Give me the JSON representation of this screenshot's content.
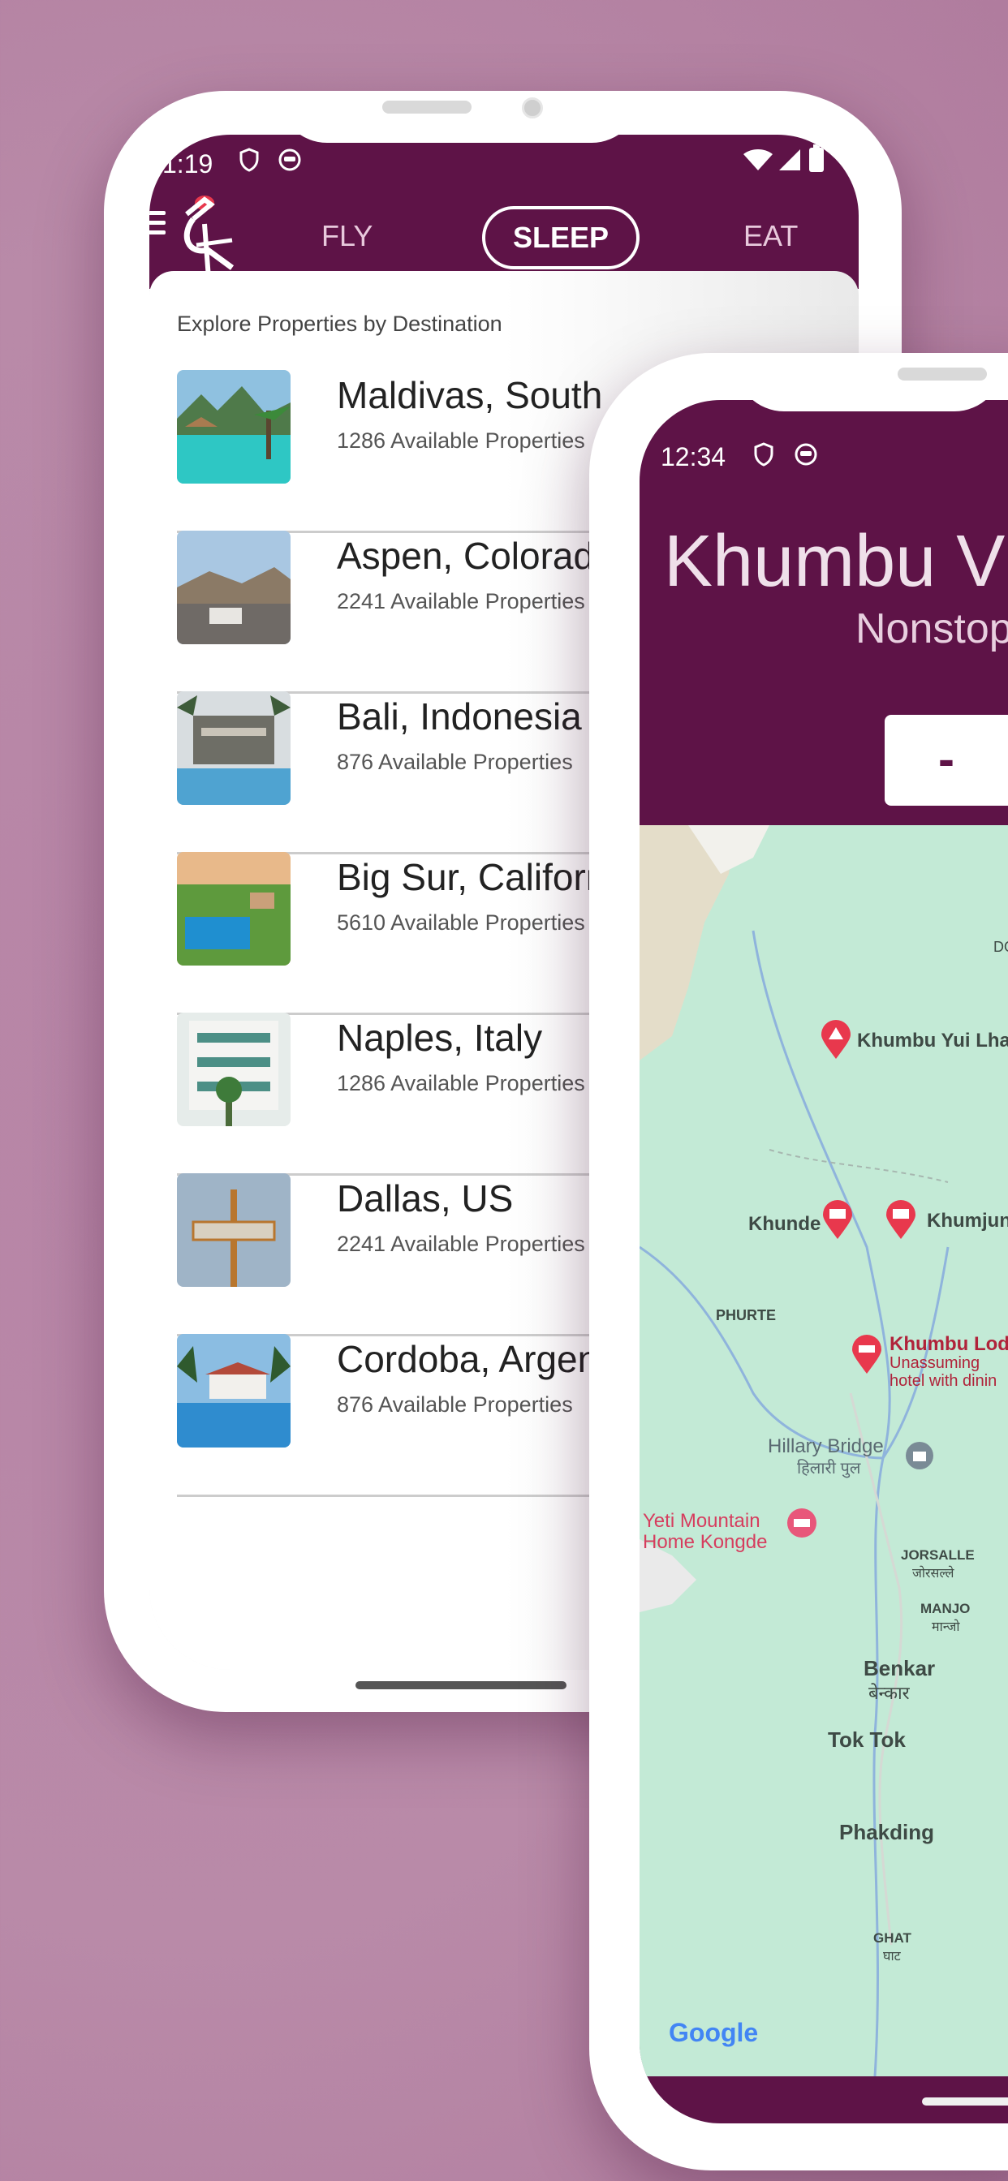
{
  "left_phone": {
    "status": {
      "time": "1:19"
    },
    "nav": {
      "tabs": [
        {
          "label": "FLY"
        },
        {
          "label": "SLEEP"
        },
        {
          "label": "EAT"
        }
      ],
      "active_tab": "SLEEP"
    },
    "section_title": "Explore Properties by Destination",
    "properties": [
      {
        "name": "Maldivas, South",
        "count": "1286 Available Properties"
      },
      {
        "name": "Aspen, Colorado",
        "count": "2241 Available Properties"
      },
      {
        "name": "Bali, Indonesia",
        "count": "876 Available Properties"
      },
      {
        "name": "Big Sur, California",
        "count": "5610 Available Properties"
      },
      {
        "name": "Naples, Italy",
        "count": "1286 Available Properties"
      },
      {
        "name": "Dallas, US",
        "count": "2241 Available Properties"
      },
      {
        "name": "Cordoba, Argentina",
        "count": "876 Available Properties"
      }
    ]
  },
  "right_phone": {
    "status": {
      "time": "12:34"
    },
    "title": "Khumbu V",
    "subtitle": "Nonstop",
    "date_field": "-",
    "map": {
      "labels": {
        "dol": "DOL",
        "yui_lha": "Khumbu Yui Lha",
        "khunde": "Khunde",
        "khumjung": "Khumjun",
        "phurte": "PHURTE",
        "lodge_name": "Khumbu Lod",
        "lodge_desc1": "Unassuming",
        "lodge_desc2": "hotel with dinin",
        "hillary": "Hillary Bridge",
        "hillary_hi": "हिलारी पुल",
        "yeti1": "Yeti Mountain",
        "yeti2": "Home Kongde",
        "jorsalle": "JORSALLE",
        "jorsalle_hi": "जोरसल्ले",
        "manjo": "MANJO",
        "manjo_hi": "मान्जो",
        "benkar": "Benkar",
        "benkar_hi": "बेन्कार",
        "toktok": "Tok Tok",
        "phakding": "Phakding",
        "ghat": "GHAT",
        "ghat_hi": "घाट"
      },
      "attribution": "Google"
    }
  },
  "colors": {
    "brand": "#5e1347",
    "background": "#b784a6",
    "pin": "#e8384d",
    "map": "#c6ecd9"
  }
}
